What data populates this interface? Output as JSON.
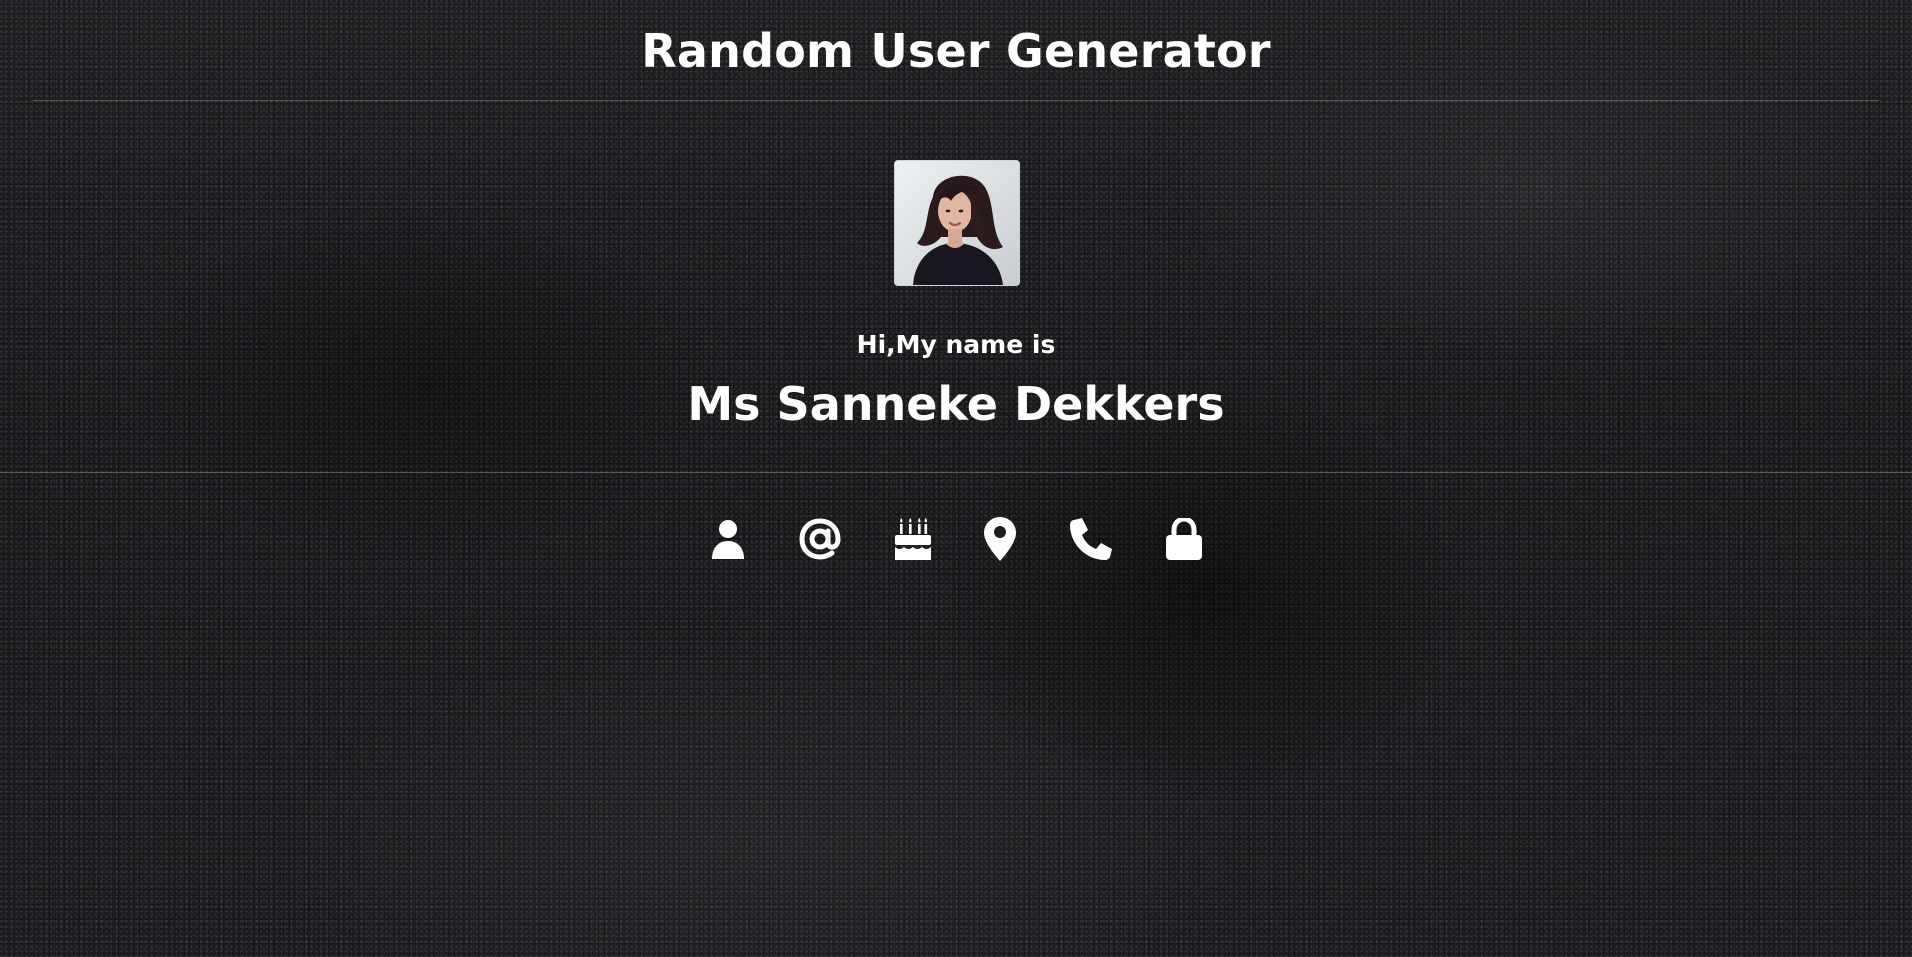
{
  "header": {
    "title": "Random User Generator"
  },
  "profile": {
    "avatar_icon": "user-photo",
    "greeting": "Hi,My name is",
    "name": "Ms Sanneke Dekkers"
  },
  "info_icons": [
    {
      "name": "user-icon"
    },
    {
      "name": "email-at-icon"
    },
    {
      "name": "birthday-cake-icon"
    },
    {
      "name": "map-marker-icon"
    },
    {
      "name": "phone-icon"
    },
    {
      "name": "lock-icon"
    }
  ],
  "colors": {
    "text": "#ffffff",
    "background": "#1d1e21",
    "divider": "rgba(255,255,255,0.25)"
  }
}
